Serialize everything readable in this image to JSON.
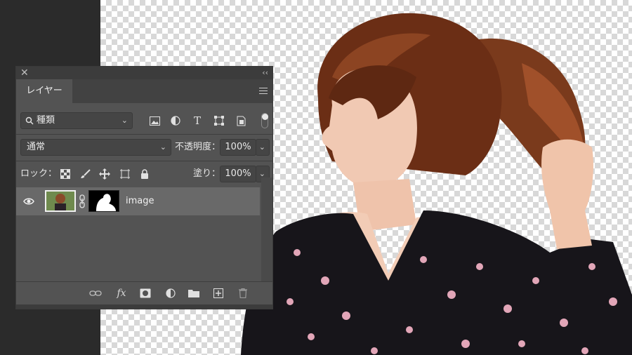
{
  "panel": {
    "tab_label": "レイヤー",
    "close_label": "✕",
    "collapse_label": "‹‹"
  },
  "filter": {
    "kind_label": "種類"
  },
  "blend": {
    "mode": "通常",
    "opacity_label": "不透明度：",
    "opacity_value": "100%"
  },
  "lock": {
    "label": "ロック：",
    "fill_label": "塗り：",
    "fill_value": "100%"
  },
  "layers": [
    {
      "name": "image",
      "visible": true,
      "has_mask": true
    }
  ],
  "colors": {
    "panel_bg": "#535353",
    "selected_row": "#696969",
    "app_bg": "#2b2b2b"
  }
}
